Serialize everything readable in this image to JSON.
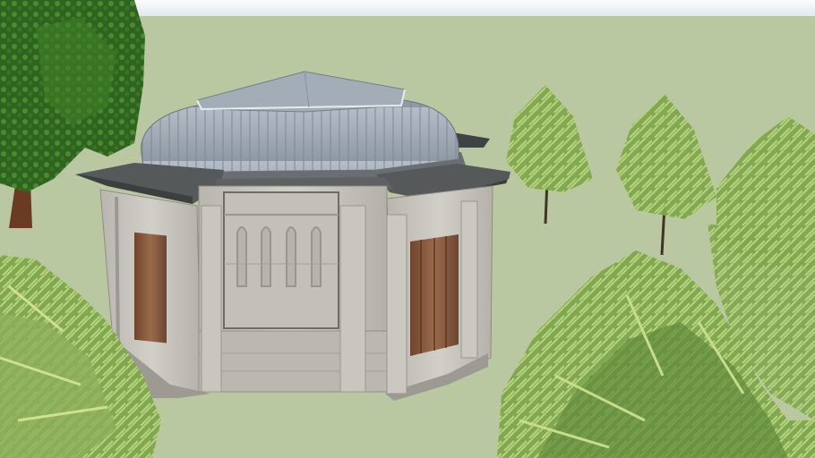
{
  "scene": {
    "colors": {
      "sky": "#eef2f6",
      "ground": "#bac8a2",
      "roof_metal": "#a9b3bd",
      "roof_slab": "#4f5354",
      "stone": "#c8c5bf",
      "stone_shadow": "#8f8c86",
      "door_wood": "#8a5d3f",
      "foliage_dark": "#2f6a1f",
      "foliage_light": "#9cbd63"
    },
    "objects": [
      {
        "name": "stone-pavilion",
        "description_icon": "domed-octagonal-building"
      },
      {
        "name": "tree",
        "description_icon": "tree-icon"
      }
    ]
  }
}
